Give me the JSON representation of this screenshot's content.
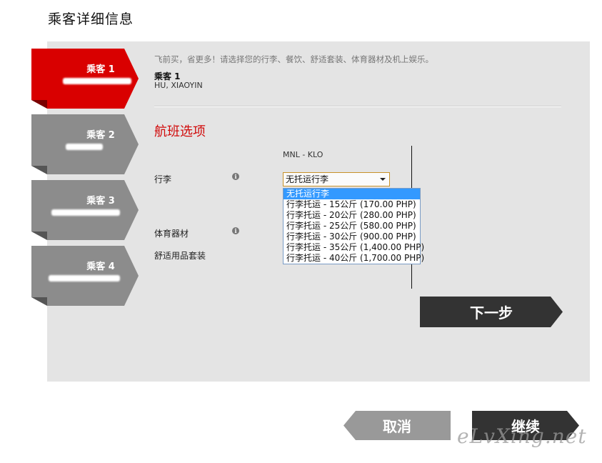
{
  "page_title": "乘客详细信息",
  "passengers": [
    {
      "label": "乘客 1",
      "active": true
    },
    {
      "label": "乘客 2",
      "active": false
    },
    {
      "label": "乘客 3",
      "active": false
    },
    {
      "label": "乘客 4",
      "active": false
    }
  ],
  "intro_text": "飞前买，省更多！请选择您的行李、餐饮、舒适套装、体育器材及机上娱乐。",
  "current_passenger": {
    "title": "乘客 1",
    "name": "HU, XIAOYIN"
  },
  "section_title": "航班选项",
  "route": "MNL - KLO",
  "rows": {
    "baggage": "行李",
    "sports": "体育器材",
    "comfort": "舒适用品套装"
  },
  "info_icon": "i",
  "baggage_select": {
    "value": "无托运行李",
    "options": [
      "无托运行李",
      "行李托运 - 15公斤 (170.00 PHP)",
      "行李托运 - 20公斤 (280.00 PHP)",
      "行李托运 - 25公斤 (580.00 PHP)",
      "行李托运 - 30公斤 (900.00 PHP)",
      "行李托运 - 35公斤 (1,400.00 PHP)",
      "行李托运 - 40公斤 (1,700.00 PHP)"
    ]
  },
  "buttons": {
    "next": "下一步",
    "cancel": "取消",
    "continue": "继续"
  },
  "watermark": "eLvXing.net",
  "colors": {
    "active_tab": "#d90000",
    "inactive_tab": "#8c8c8c",
    "dark_button": "#333333",
    "cancel_button": "#999999",
    "section_title": "#d10a0a"
  }
}
